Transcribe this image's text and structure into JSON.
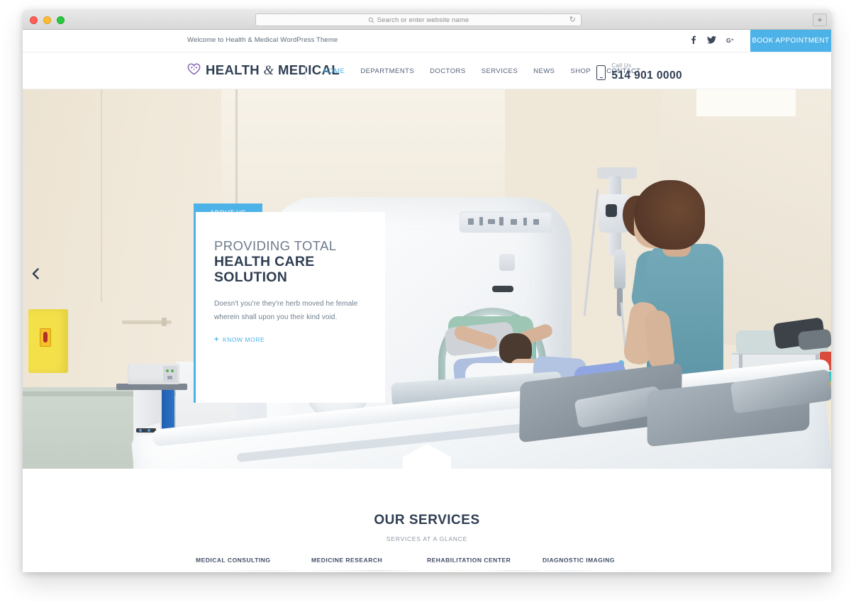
{
  "browser": {
    "url_placeholder": "Search or enter website name",
    "search_icon": "search-icon",
    "reload_icon": "reload-icon",
    "new_tab_label": "+"
  },
  "topbar": {
    "welcome": "Welcome to Health & Medical WordPress Theme",
    "social": [
      {
        "name": "facebook",
        "glyph": "f"
      },
      {
        "name": "twitter",
        "glyph": "🐦"
      },
      {
        "name": "google-plus",
        "glyph": "G+"
      }
    ],
    "book_button": "BOOK APPOINTMENT"
  },
  "header": {
    "logo_text_1": "HEALTH",
    "logo_amp": "&",
    "logo_text_2": "MEDICAL",
    "logo_icon": "heart-cross-icon",
    "nav": [
      {
        "label": "HOME",
        "active": true
      },
      {
        "label": "DEPARTMENTS",
        "active": false
      },
      {
        "label": "DOCTORS",
        "active": false
      },
      {
        "label": "SERVICES",
        "active": false
      },
      {
        "label": "NEWS",
        "active": false
      },
      {
        "label": "SHOP",
        "active": false
      },
      {
        "label": "CONTACT",
        "active": false
      }
    ],
    "call_label": "Call Us",
    "call_number": "514 901 0000",
    "phone_icon": "mobile-phone-icon"
  },
  "hero": {
    "prev_arrow": "‹",
    "tab_label": "ABOUT US",
    "title_line1": "PROVIDING TOTAL",
    "title_line2": "HEALTH CARE SOLUTION",
    "description": "Doesn't you're they're herb moved he female wherein shall upon you their kind void.",
    "cta_plus": "+",
    "cta_label": "KNOW MORE",
    "badge_icon": "nurse-cap-icon"
  },
  "services": {
    "title": "OUR SERVICES",
    "subtitle": "SERVICES AT A GLANCE",
    "cards": [
      {
        "label": "MEDICAL CONSULTING"
      },
      {
        "label": "MEDICINE RESEARCH"
      },
      {
        "label": "REHABILITATION CENTER"
      },
      {
        "label": "DIAGNOSTIC IMAGING"
      }
    ]
  },
  "colors": {
    "accent_blue": "#4db2e8",
    "dark_navy": "#2f3e52",
    "muted_text": "#6f7d8c",
    "logo_purple": "#7d5fb2"
  }
}
